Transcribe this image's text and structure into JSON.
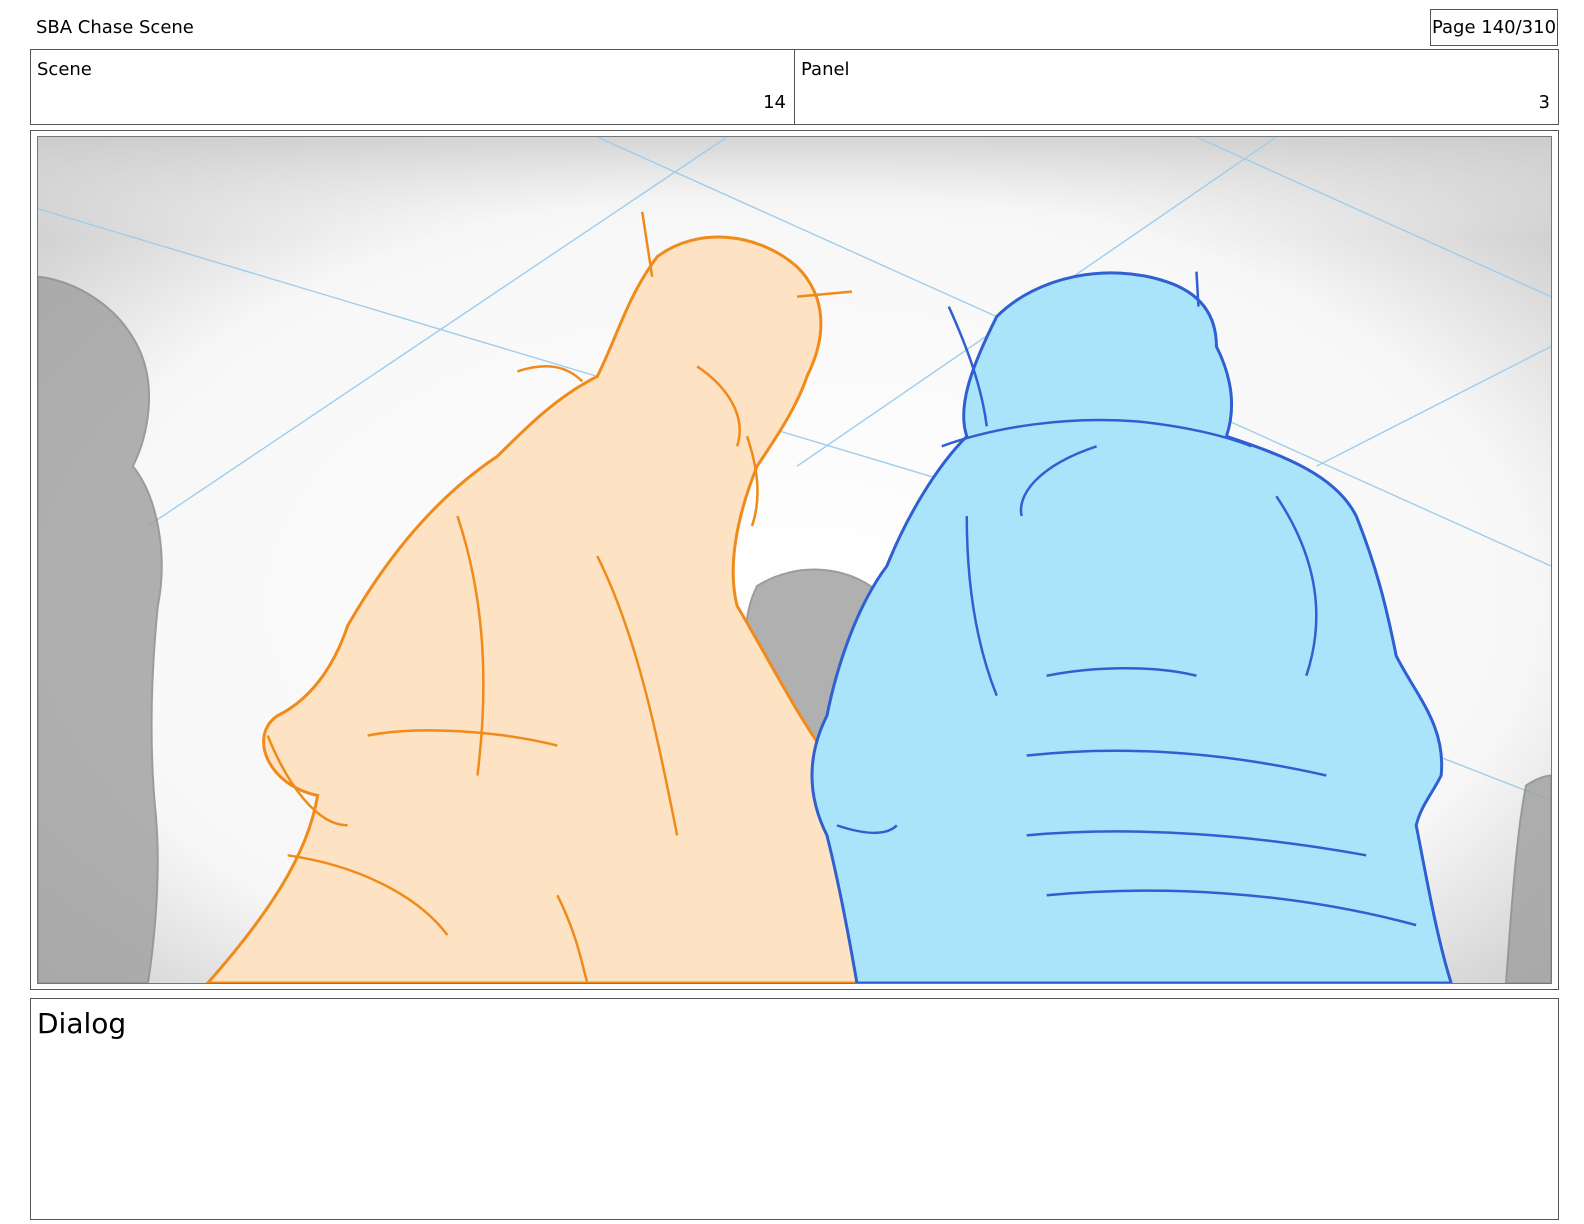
{
  "document": {
    "title": "SBA Chase Scene",
    "page_indicator": "Page 140/310"
  },
  "meta": {
    "scene": {
      "label": "Scene",
      "value": "14"
    },
    "panel": {
      "label": "Panel",
      "value": "3"
    }
  },
  "panel_image": {
    "icon": "storyboard-sketch",
    "colors": {
      "orange_fill": "#fde3c4",
      "orange_line": "#f08a1a",
      "blue_fill": "#a9e4fb",
      "blue_line": "#2f5fd0",
      "background_figure": "#9a9a9a",
      "guide_lines": "#9fcdec"
    }
  },
  "dialog": {
    "label": "Dialog",
    "text": ""
  }
}
